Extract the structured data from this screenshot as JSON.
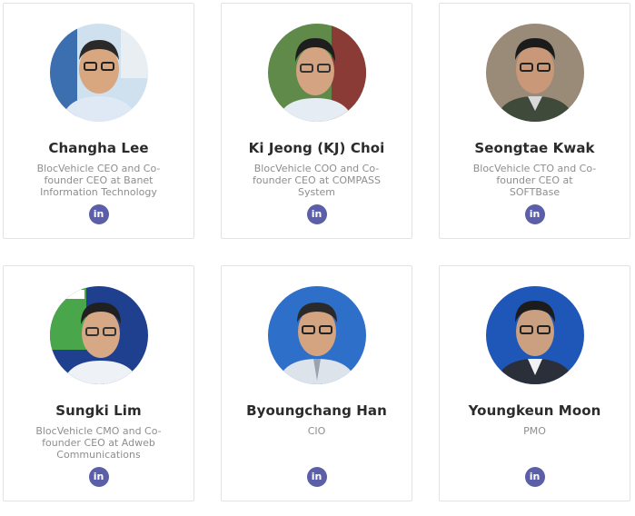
{
  "members": [
    {
      "name": "Changha Lee",
      "role": "BlocVehicle CEO and Co-founder CEO at Banet Information Technology",
      "linkedin": "in"
    },
    {
      "name": "Ki Jeong (KJ) Choi",
      "role": "BlocVehicle COO and Co-founder CEO at COMPASS System",
      "linkedin": "in"
    },
    {
      "name": "Seongtae Kwak",
      "role": "BlocVehicle CTO and Co-founder CEO at SOFTBase",
      "linkedin": "in"
    },
    {
      "name": "Sungki Lim",
      "role": "BlocVehicle CMO and Co-founder CEO at Adweb Communications",
      "linkedin": "in"
    },
    {
      "name": "Byoungchang Han",
      "role": "CIO",
      "linkedin": "in"
    },
    {
      "name": "Youngkeun Moon",
      "role": "PMO",
      "linkedin": "in"
    }
  ],
  "colors": {
    "linkedin_badge": "#5b5fa8",
    "name_text": "#2b2b2b",
    "role_text": "#8e8e8e",
    "card_border": "#e3e3e3"
  },
  "icons": {
    "linkedin": "linkedin-icon"
  }
}
